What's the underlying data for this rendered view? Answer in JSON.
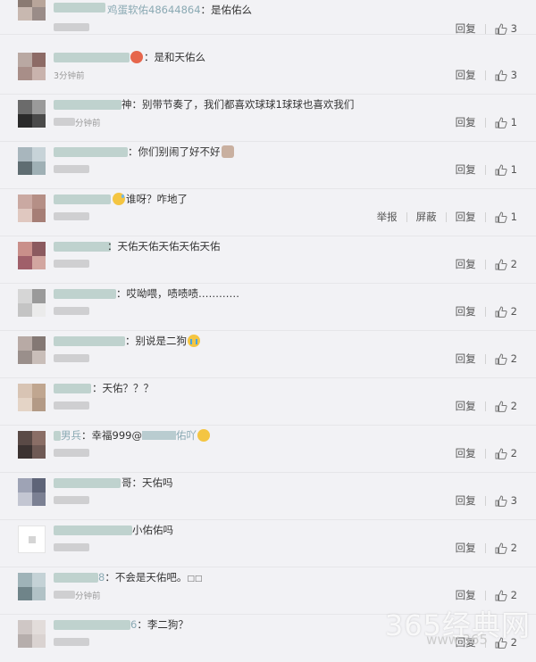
{
  "colors": {
    "background": "#f2f2f5",
    "text": "#333333",
    "meta": "#9a9a9a",
    "divider": "#e6e6e9"
  },
  "labels": {
    "reply": "回复",
    "report": "举报",
    "block": "屏蔽"
  },
  "comments": [
    {
      "name_visible": "鸡蛋软佑48644864",
      "text": "：是佑佑么",
      "time": "",
      "likes": "3",
      "emoji": ""
    },
    {
      "name_visible": "",
      "text": "：是和天佑么",
      "time": "3分钟前",
      "likes": "3",
      "emoji": "red"
    },
    {
      "name_visible": "",
      "text": "神：别带节奏了，我们都喜欢球球1球球也喜欢我们",
      "time": "分钟前",
      "likes": "1",
      "emoji": ""
    },
    {
      "name_visible": "",
      "text": "：你们别闹了好不好",
      "time": "",
      "likes": "1",
      "emoji": "hands"
    },
    {
      "name_visible": "",
      "text": "谁呀？咋地了",
      "time": "",
      "likes": "1",
      "emoji": "sweat"
    },
    {
      "name_visible": "",
      "text": "：天佑天佑天佑天佑天佑",
      "time": "",
      "likes": "2",
      "emoji": ""
    },
    {
      "name_visible": "",
      "text": "：哎呦喂，啧啧啧…………",
      "time": "",
      "likes": "2",
      "emoji": ""
    },
    {
      "name_visible": "",
      "text": "：别说是二狗",
      "time": "",
      "likes": "2",
      "emoji": "cry"
    },
    {
      "name_visible": "",
      "text": "：天佑？？？",
      "time": "",
      "likes": "2",
      "emoji": ""
    },
    {
      "name_visible": "男兵",
      "text": "：幸福999@",
      "text2": "佑吖",
      "time": "",
      "likes": "2",
      "emoji": "smile"
    },
    {
      "name_visible": "",
      "text": "哥：天佑吗",
      "time": "",
      "likes": "3",
      "emoji": ""
    },
    {
      "name_visible": "",
      "text": "小佑佑吗",
      "time": "",
      "likes": "2",
      "emoji": ""
    },
    {
      "name_visible": "8",
      "text": "：不会是天佑吧。",
      "squares": "□□",
      "time": "分钟前",
      "likes": "2",
      "emoji": ""
    },
    {
      "name_visible": "6",
      "text": "：李二狗？",
      "time": "",
      "likes": "2",
      "emoji": ""
    }
  ],
  "watermark": {
    "main": "365经典网",
    "sub": "www.365"
  }
}
